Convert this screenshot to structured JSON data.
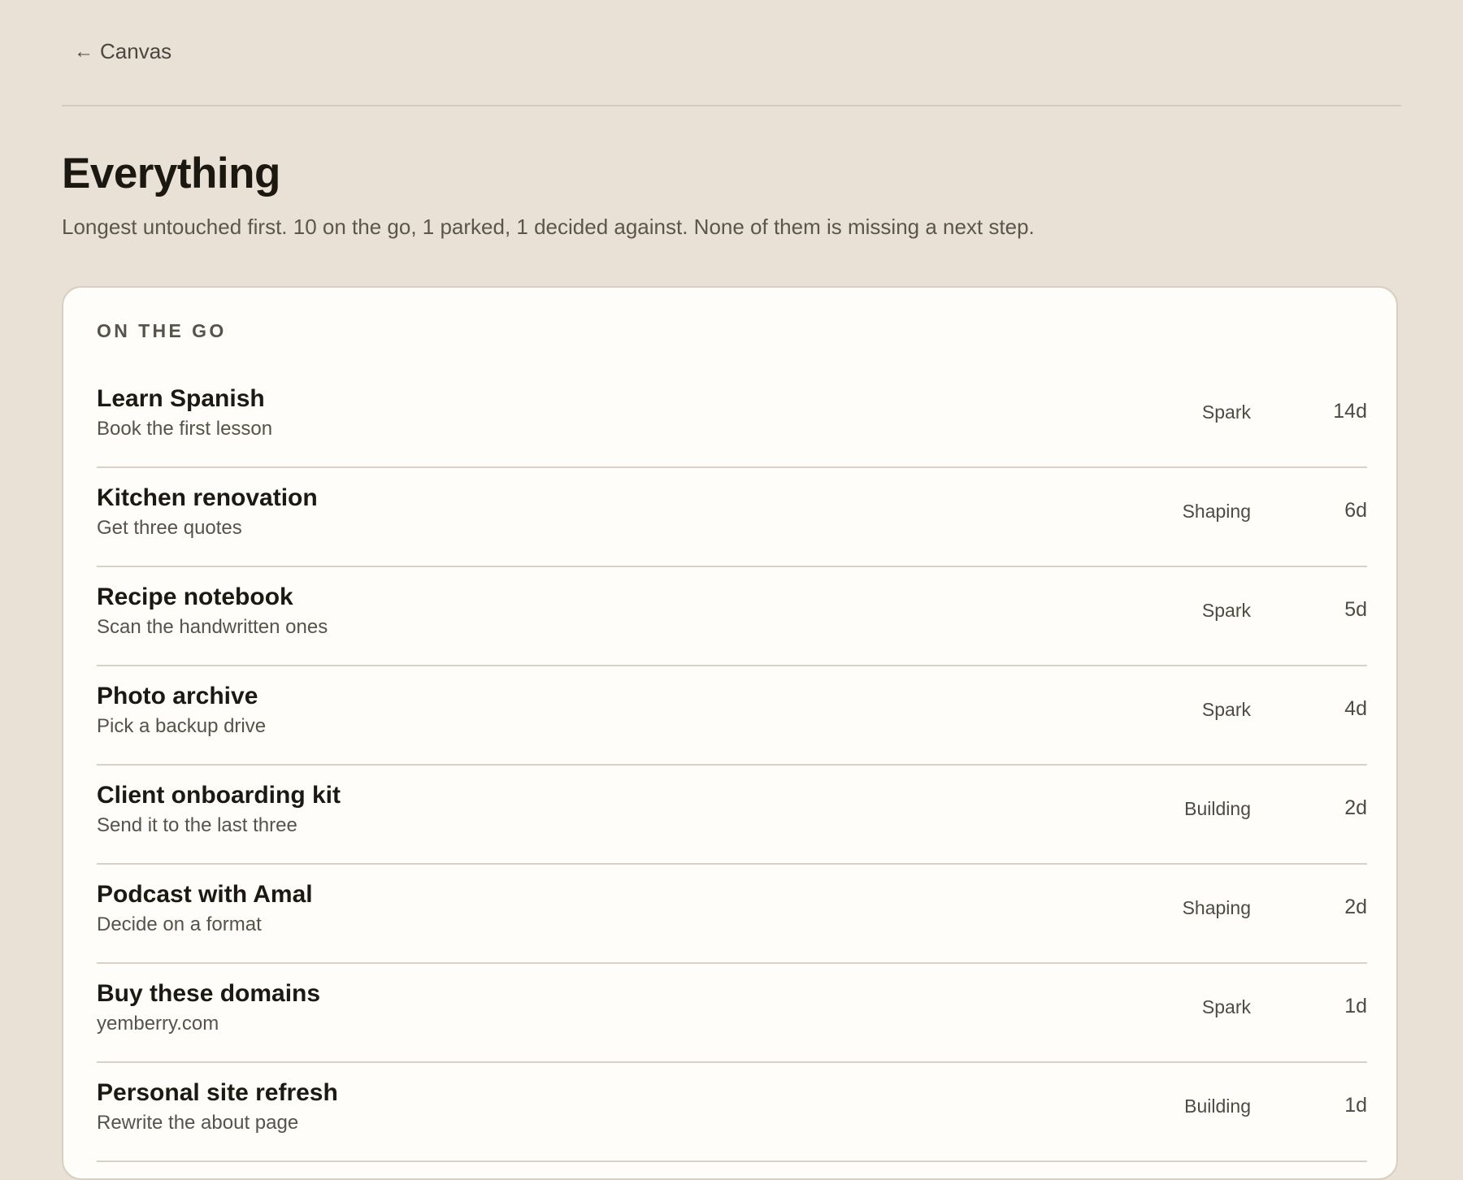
{
  "nav": {
    "back_label": "Canvas"
  },
  "header": {
    "title": "Everything",
    "subtitle": "Longest untouched first. 10 on the go, 1 parked, 1 decided against. None of them is missing a next step."
  },
  "section": {
    "label": "ON THE GO",
    "items": [
      {
        "title": "Learn Spanish",
        "next_step": "Book the first lesson",
        "stage": "Spark",
        "age": "14d"
      },
      {
        "title": "Kitchen renovation",
        "next_step": "Get three quotes",
        "stage": "Shaping",
        "age": "6d"
      },
      {
        "title": "Recipe notebook",
        "next_step": "Scan the handwritten ones",
        "stage": "Spark",
        "age": "5d"
      },
      {
        "title": "Photo archive",
        "next_step": "Pick a backup drive",
        "stage": "Spark",
        "age": "4d"
      },
      {
        "title": "Client onboarding kit",
        "next_step": "Send it to the last three",
        "stage": "Building",
        "age": "2d"
      },
      {
        "title": "Podcast with Amal",
        "next_step": "Decide on a format",
        "stage": "Shaping",
        "age": "2d"
      },
      {
        "title": "Buy these domains",
        "next_step": "yemberry.com",
        "stage": "Spark",
        "age": "1d"
      },
      {
        "title": "Personal site refresh",
        "next_step": "Rewrite the about page",
        "stage": "Building",
        "age": "1d"
      }
    ]
  },
  "icons": {
    "back": "arrow-left-icon"
  },
  "colors": {
    "background": "#e9e1d5",
    "card": "#fefdf9",
    "divider": "#d9d1c4",
    "text_primary": "#1c1912",
    "text_secondary": "#57524a"
  }
}
